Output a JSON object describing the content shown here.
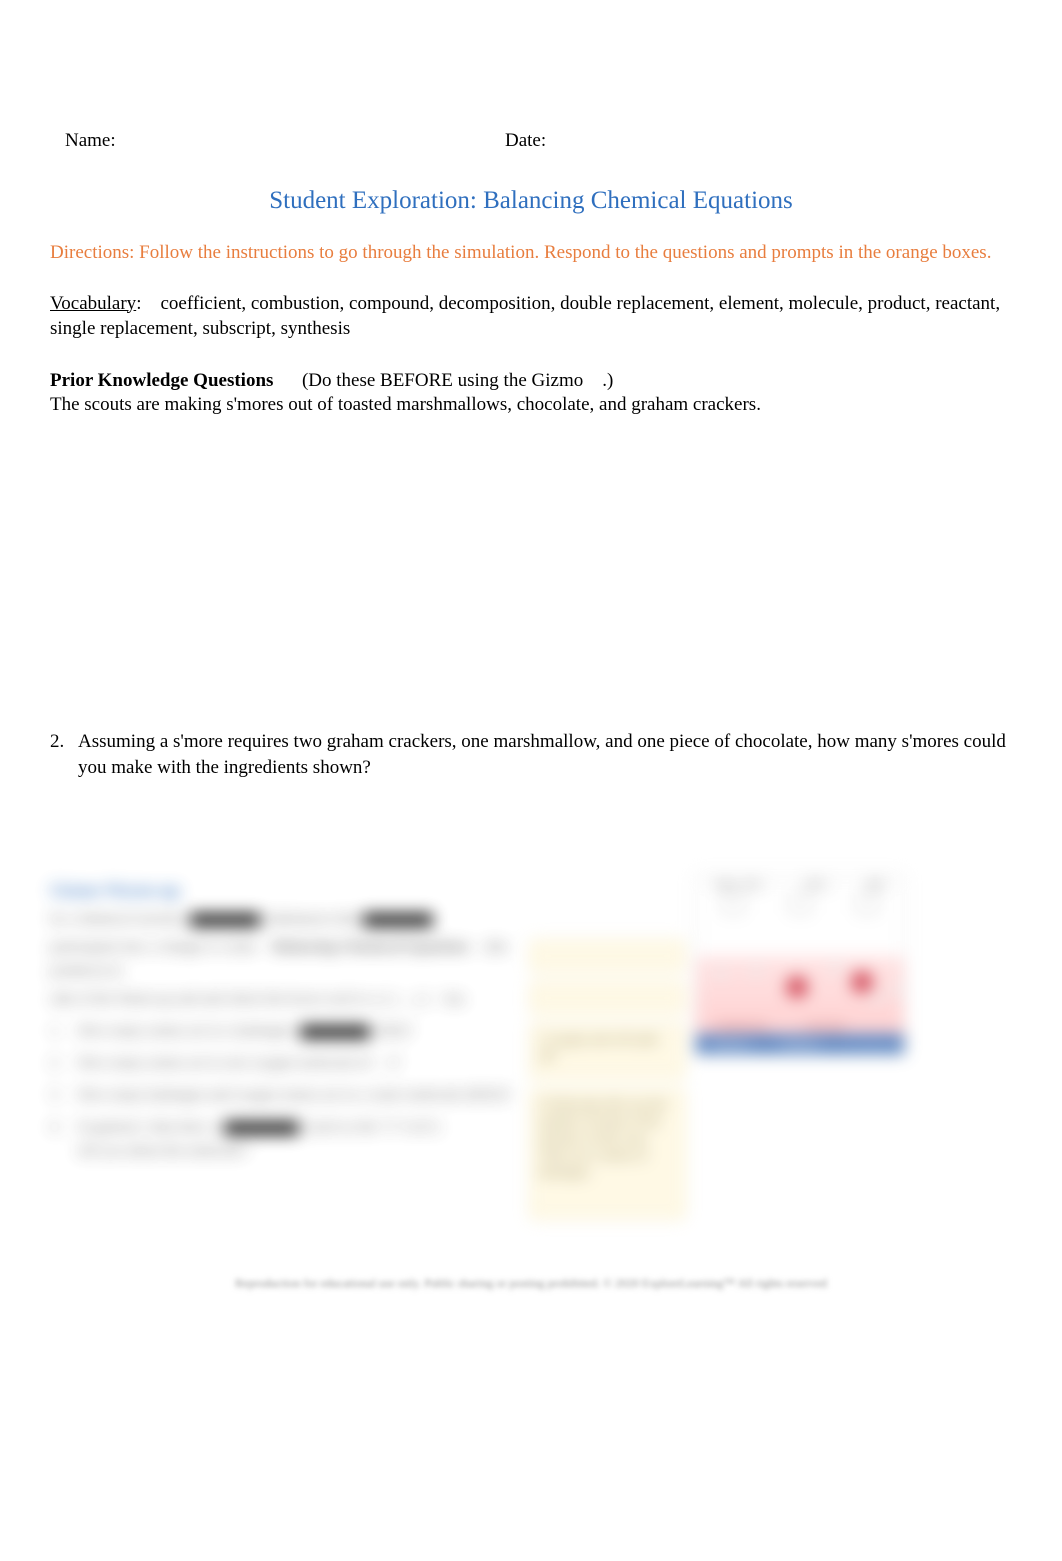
{
  "header": {
    "name_label": "Name:",
    "date_label": "Date:"
  },
  "title": "Student Exploration: Balancing Chemical Equations",
  "directions": "Directions: Follow the instructions to go through the simulation. Respond to the questions and prompts in the orange boxes.",
  "vocab": {
    "label": "Vocabulary",
    "colon": ":",
    "body": "coefficient, combustion, compound, decomposition, double replacement, element, molecule, product, reactant, single replacement, subscript, synthesis"
  },
  "prior": {
    "label": "Prior Knowledge Questions",
    "paren": "(Do these BEFORE using the Gizmo",
    "paren_close": ".)"
  },
  "scouts": "The scouts are making s'mores out of toasted marshmallows, chocolate, and graham crackers.",
  "q2": {
    "num": "2.",
    "text": "Assuming a s'more requires two graham crackers, one marshmallow, and one piece of chocolate, how many s'mores could you make with the ingredients shown?"
  },
  "blurred": {
    "gw_title": "Gizmo Warm-up",
    "line1a": "In a chemical reaction,",
    "line1b": "(substances that",
    "line2a": "participate) into a change to create",
    "line2b": "(the products) in",
    "line3a": "side of the Warm-up and and check the boxes each to a ( )",
    "line3b": "_ ( )",
    "line3c": "has",
    "q1": {
      "n": "1.",
      "t1": "How many atoms are in a hydrogen",
      "t2": "(H2)?"
    },
    "q2": {
      "n": "2.",
      "t": "How many atoms are in one oxygen molecule (O",
      "t2": ")?"
    },
    "q3": {
      "n": "3.",
      "t": "How many hydrogen and oxygen atoms are in a water molecule (H2O)?"
    },
    "q4": {
      "n": "4.",
      "t1": "In general, what does a",
      "t2": "(such as the \"2\" in H",
      "t3": ")",
      "t4": "tell you about the molecule?"
    },
    "ans_c": "1 oxygen and will split 2H",
    "ans_d": "A Subscript tells you the number of atoms of the element. In this  case, There are 2 atoms of hydrogen.",
    "thumb": {
      "top": [
        "Water: 2H2 →",
        "+2H2 →",
        "H2O"
      ],
      "labels": [
        "HYDROGEN",
        "OXYGEN"
      ],
      "btns": [
        "Reactant",
        "Reactant",
        "→"
      ]
    }
  },
  "footer": "Reproduction for educational use only. Public sharing or posting prohibited. © 2020 ExploreLearning™ All rights reserved"
}
